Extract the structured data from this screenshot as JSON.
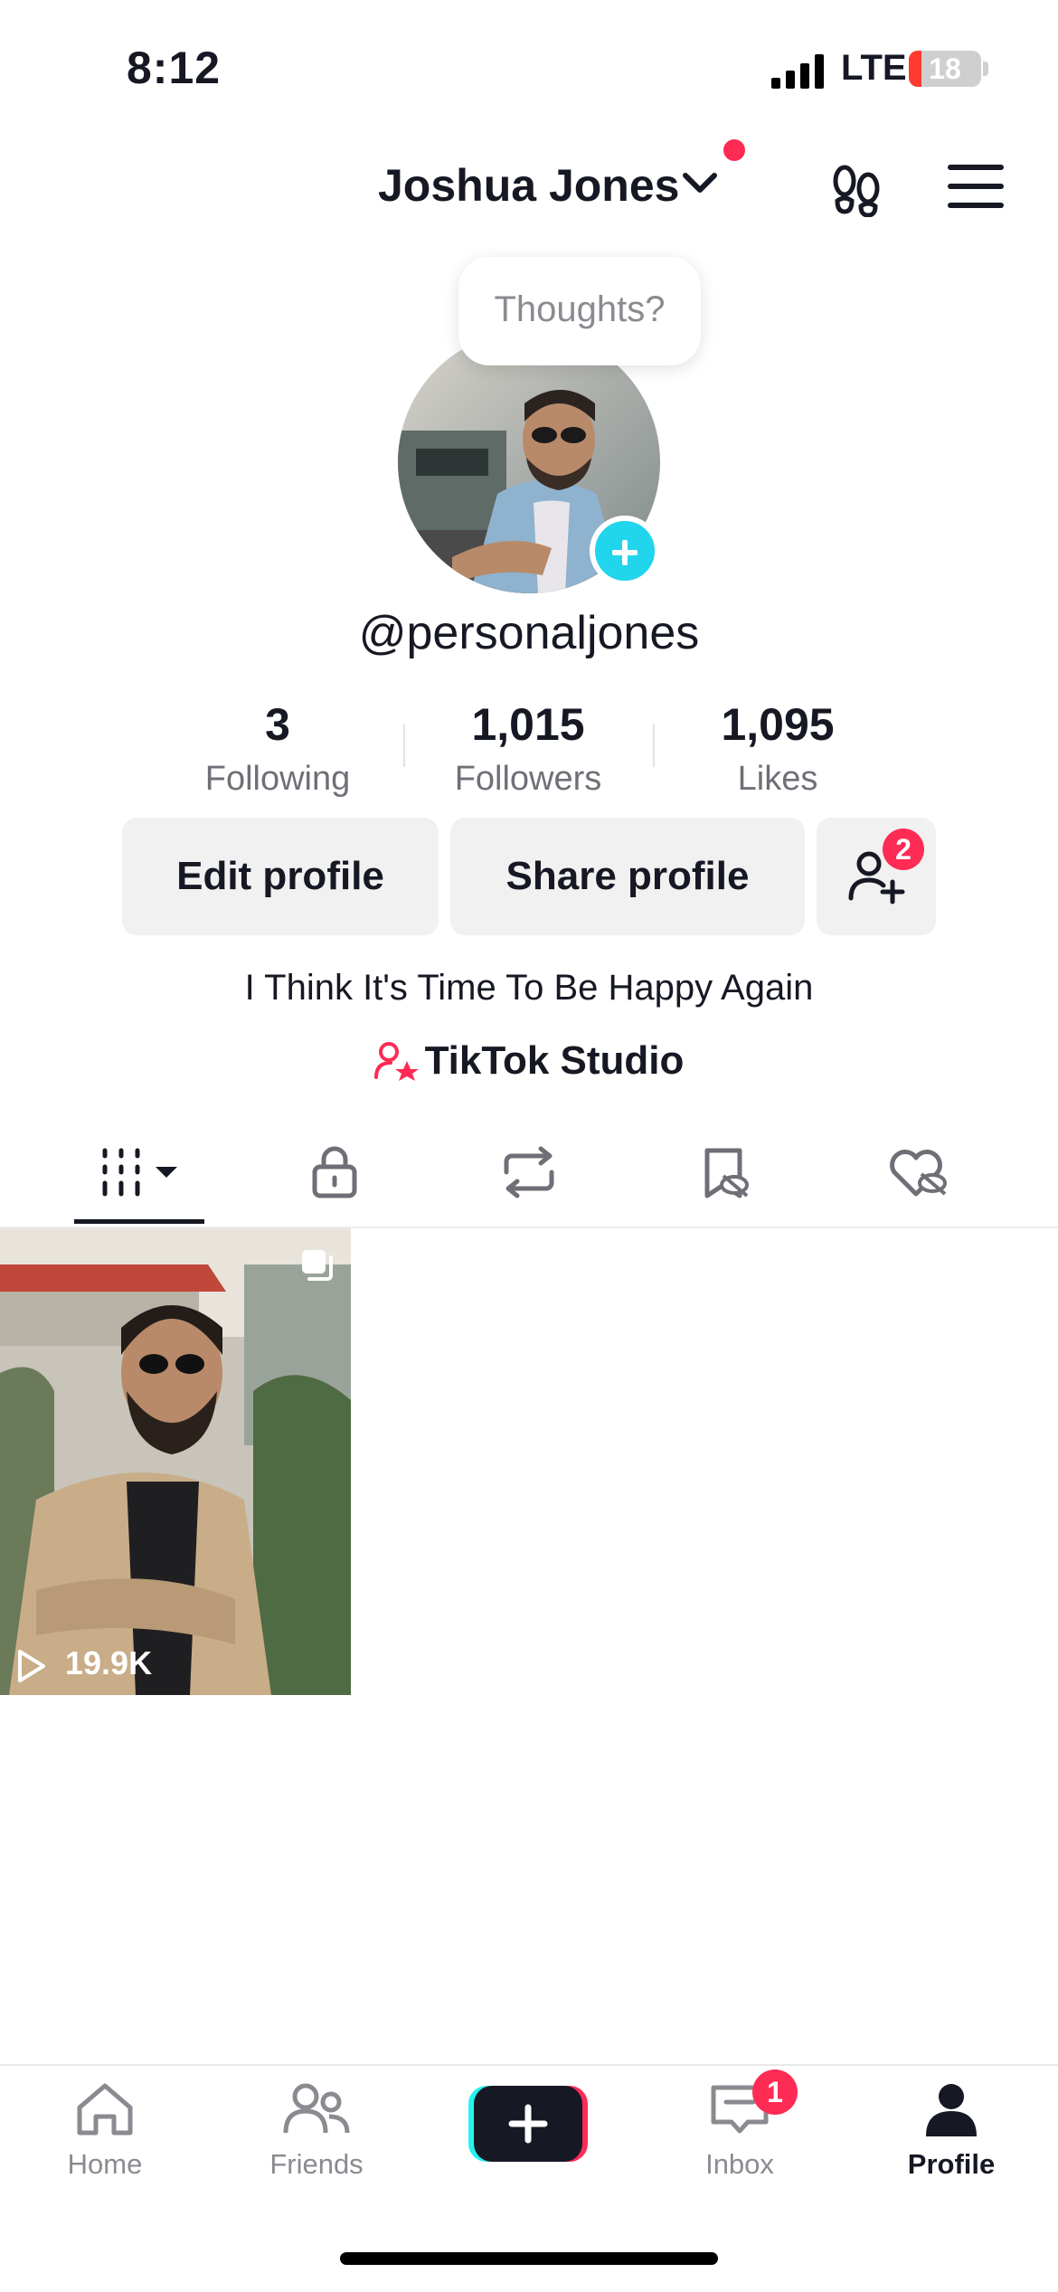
{
  "status_bar": {
    "time": "8:12",
    "network": "LTE",
    "battery": "18",
    "battery_level": 0.18
  },
  "header": {
    "name": "Joshua Jones"
  },
  "avatar": {
    "thought_bubble": "Thoughts?"
  },
  "profile": {
    "username": "@personaljones",
    "bio": "I Think It's Time To Be Happy Again",
    "studio_link": "TikTok Studio"
  },
  "stats": [
    {
      "value": "3",
      "label": "Following"
    },
    {
      "value": "1,015",
      "label": "Followers"
    },
    {
      "value": "1,095",
      "label": "Likes"
    }
  ],
  "buttons": {
    "edit": "Edit profile",
    "share": "Share profile",
    "add_friends_badge": "2"
  },
  "tabs": [
    "videos-grid-icon",
    "lock-icon",
    "repost-icon",
    "saved-hidden-icon",
    "liked-hidden-icon"
  ],
  "videos": [
    {
      "views": "19.9K"
    }
  ],
  "nav": {
    "home": "Home",
    "friends": "Friends",
    "inbox": "Inbox",
    "inbox_badge": "1",
    "profile": "Profile"
  },
  "colors": {
    "accent": "#fe2c55",
    "cyan": "#20d5ec",
    "text": "#161823"
  }
}
